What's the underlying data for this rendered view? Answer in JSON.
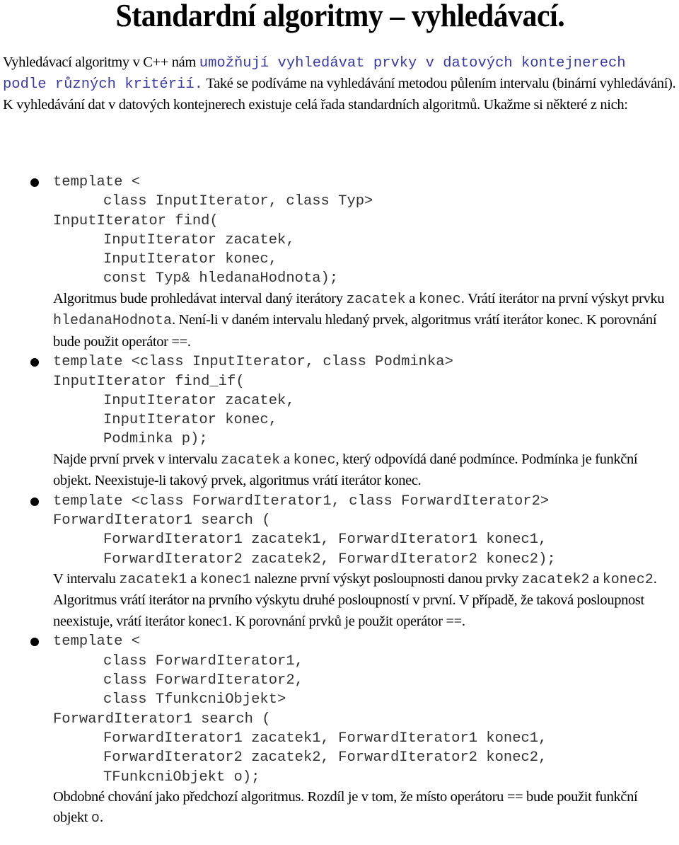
{
  "title": "Standardní algoritmy – vyhledávací.",
  "intro": {
    "p1_prefix": "Vyhledávací algoritmy v C++ nám ",
    "p1_mono": "umožňují vyhledávat prvky v datových kontejnerech podle různých kritérií.",
    "p1_suffix": " Také se podíváme na vyhledávání metodou půlením intervalu (binární vyhledávání).",
    "p2": "K vyhledávání dat v datových kontejnerech existuje celá řada standardních algoritmů. Ukažme si některé z nich:"
  },
  "algorithms": [
    {
      "code": [
        {
          "indent": 0,
          "text": "template <"
        },
        {
          "indent": 1,
          "text": "class InputIterator, class Typ>"
        },
        {
          "indent": 0,
          "text": "InputIterator find("
        },
        {
          "indent": 1,
          "text": "InputIterator zacatek,"
        },
        {
          "indent": 1,
          "text": "InputIterator konec,"
        },
        {
          "indent": 1,
          "text": "const Typ& hledanaHodnota);"
        }
      ],
      "description": [
        {
          "t": "Algoritmus bude prohledávat interval daný iterátory "
        },
        {
          "m": "zacatek"
        },
        {
          "t": " a "
        },
        {
          "m": "konec"
        },
        {
          "t": ". Vrátí iterátor na první výskyt prvku "
        },
        {
          "m": "hledanaHodnota"
        },
        {
          "t": ". Není-li v daném intervalu hledaný prvek, algoritmus vrátí iterátor konec. K porovnání bude použit operátor ==."
        }
      ]
    },
    {
      "code": [
        {
          "indent": 0,
          "text": "template <class InputIterator, class Podminka>"
        },
        {
          "indent": 0,
          "text": "InputIterator find_if("
        },
        {
          "indent": 1,
          "text": "InputIterator zacatek,"
        },
        {
          "indent": 1,
          "text": "InputIterator konec,"
        },
        {
          "indent": 1,
          "text": "Podminka p);"
        }
      ],
      "description": [
        {
          "t": "Najde první prvek v intervalu "
        },
        {
          "m": "zacatek"
        },
        {
          "t": " a "
        },
        {
          "m": "konec"
        },
        {
          "t": ", který odpovídá dané podmínce. Podmínka je funkční objekt. Neexistuje-li takový prvek, algoritmus vrátí iterátor konec."
        }
      ]
    },
    {
      "code": [
        {
          "indent": 0,
          "text": "template <class ForwardIterator1, class ForwardIterator2>"
        },
        {
          "indent": 0,
          "text": "ForwardIterator1 search ("
        },
        {
          "indent": 1,
          "text": "ForwardIterator1 zacatek1, ForwardIterator1 konec1,"
        },
        {
          "indent": 1,
          "text": "ForwardIterator2 zacatek2, ForwardIterator2 konec2);"
        }
      ],
      "description": [
        {
          "t": "V intervalu "
        },
        {
          "m": "zacatek1"
        },
        {
          "t": " a "
        },
        {
          "m": "konec1"
        },
        {
          "t": " nalezne první výskyt posloupnosti danou prvky "
        },
        {
          "m": "zacatek2"
        },
        {
          "t": " a "
        },
        {
          "m": "konec2"
        },
        {
          "t": ". Algoritmus vrátí iterátor na prvního výskytu druhé posloupností v první. V případě, že taková posloupnost neexistuje, vrátí iterátor konec1. K porovnání prvků je použit operátor ==."
        }
      ]
    },
    {
      "code": [
        {
          "indent": 0,
          "text": "template <"
        },
        {
          "indent": 1,
          "text": "class ForwardIterator1,"
        },
        {
          "indent": 1,
          "text": "class ForwardIterator2,"
        },
        {
          "indent": 1,
          "text": "class TfunkcniObjekt>"
        },
        {
          "indent": 0,
          "text": "ForwardIterator1 search ("
        },
        {
          "indent": 1,
          "text": "ForwardIterator1 zacatek1, ForwardIterator1 konec1,"
        },
        {
          "indent": 1,
          "text": "ForwardIterator2 zacatek2, ForwardIterator2 konec2,"
        },
        {
          "indent": 1,
          "text": "TFunkcniObjekt o);"
        }
      ],
      "description": [
        {
          "t": "Obdobné chování jako předchozí algoritmus. Rozdíl je v tom, že místo operátoru == bude použit funkční objekt "
        },
        {
          "m": "o"
        },
        {
          "t": "."
        }
      ]
    }
  ]
}
